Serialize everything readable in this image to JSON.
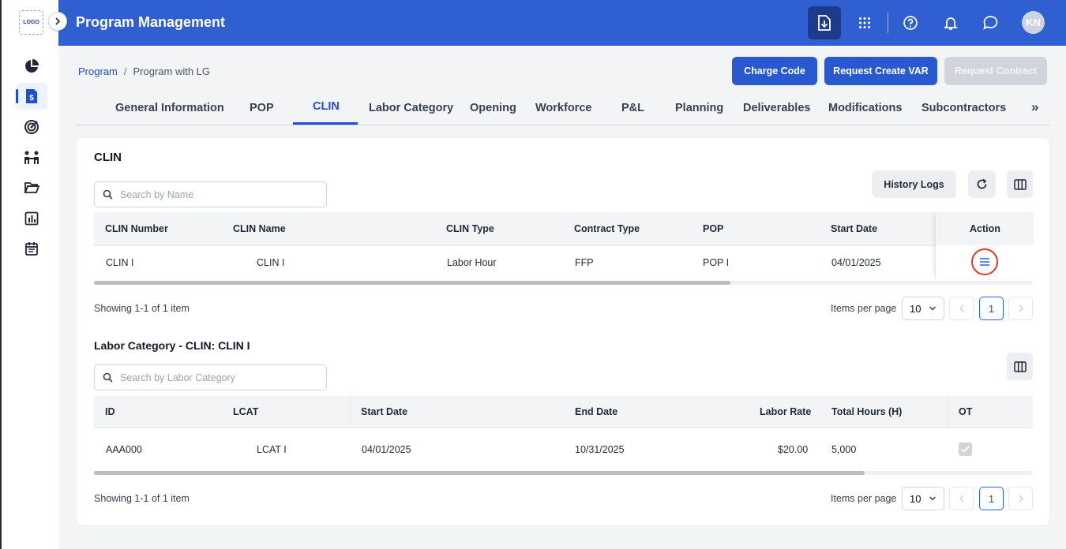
{
  "logo": "LOGO",
  "header": {
    "title": "Program Management",
    "avatar_initials": "KN"
  },
  "breadcrumb": {
    "root": "Program",
    "separator": "/",
    "current": "Program with LG"
  },
  "actions": {
    "charge_code": "Charge Code",
    "request_var": "Request Create VAR",
    "request_contract": "Request Contract"
  },
  "tabs": [
    {
      "label": "General Information"
    },
    {
      "label": "POP"
    },
    {
      "label": "CLIN",
      "active": true
    },
    {
      "label": "Labor Category"
    },
    {
      "label": "Opening"
    },
    {
      "label": "Workforce"
    },
    {
      "label": "P&L"
    },
    {
      "label": "Planning"
    },
    {
      "label": "Deliverables"
    },
    {
      "label": "Modifications"
    },
    {
      "label": "Subcontractors"
    }
  ],
  "tabs_more": "»",
  "clin": {
    "title": "CLIN",
    "search_placeholder": "Search by Name",
    "history_logs": "History Logs",
    "columns": [
      "CLIN Number",
      "CLIN Name",
      "CLIN Type",
      "Contract Type",
      "POP",
      "Start Date",
      "Action"
    ],
    "rows": [
      {
        "clin_number": "CLIN I",
        "clin_name": "CLIN I",
        "clin_type": "Labor Hour",
        "contract_type": "FFP",
        "pop": "POP I",
        "start_date": "04/01/2025"
      }
    ],
    "showing": "Showing 1-1 of 1 item",
    "items_per_page_label": "Items per page",
    "items_per_page": "10",
    "page": "1"
  },
  "labor": {
    "title": "Labor Category - CLIN: CLIN I",
    "search_placeholder": "Search by Labor Category",
    "columns": [
      "ID",
      "LCAT",
      "Start Date",
      "End Date",
      "Labor Rate",
      "Total Hours (H)",
      "OT"
    ],
    "rows": [
      {
        "id": "AAA000",
        "lcat": "LCAT I",
        "start_date": "04/01/2025",
        "end_date": "10/31/2025",
        "labor_rate": "$20.00",
        "total_hours": "5,000",
        "ot": true
      }
    ],
    "showing": "Showing 1-1 of 1 item",
    "items_per_page_label": "Items per page",
    "items_per_page": "10",
    "page": "1"
  },
  "colors": {
    "header_bg": "#2f5fd1",
    "primary": "#2859d0",
    "accent_text": "#1d4ed8",
    "highlight_ring": "#e3362c"
  },
  "icons": {
    "sidebar": [
      "pie-chart-icon",
      "dollar-document-icon",
      "target-icon",
      "people-icon",
      "folder-icon",
      "bar-chart-icon",
      "calendar-icon"
    ],
    "header": [
      "download-icon",
      "apps-grid-icon",
      "help-icon",
      "bell-icon",
      "chat-icon"
    ]
  }
}
